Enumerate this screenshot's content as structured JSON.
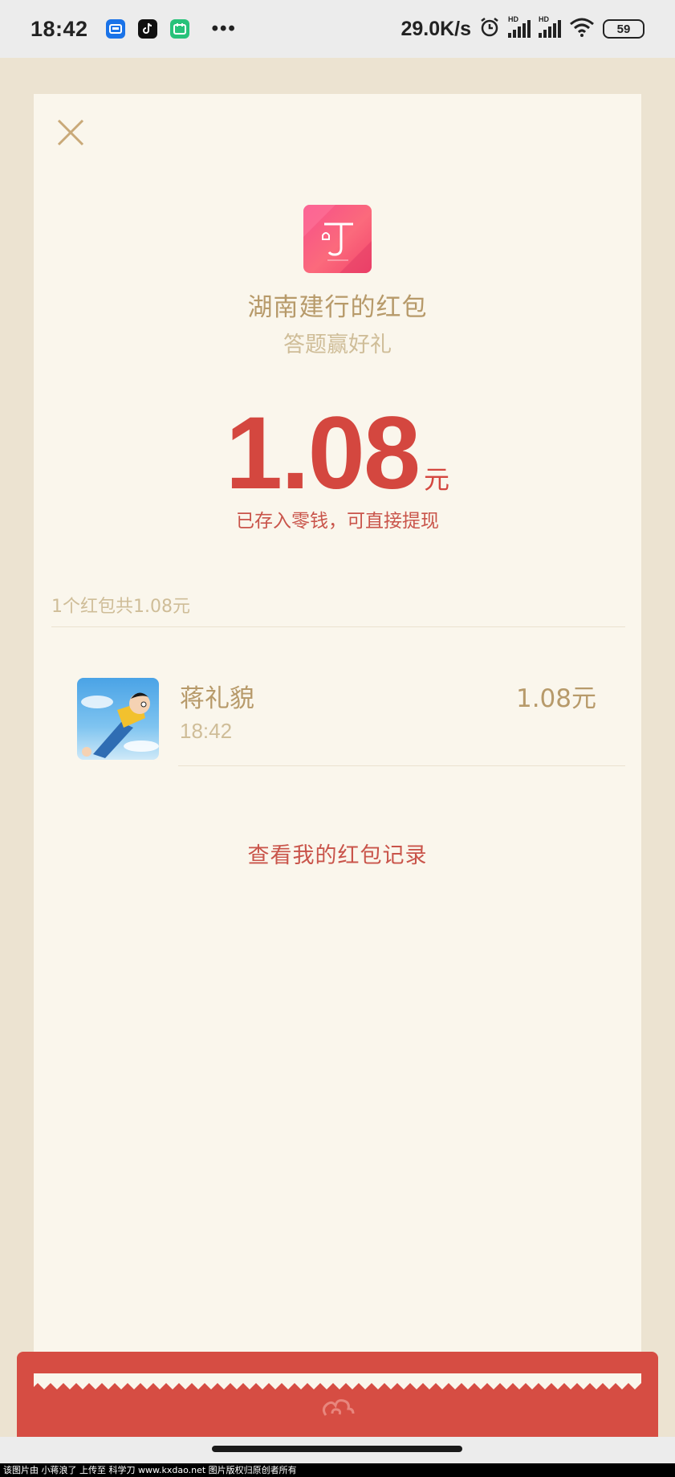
{
  "status_bar": {
    "time": "18:42",
    "app_icons": [
      "messenger-icon",
      "tiktok-icon",
      "calendar-icon"
    ],
    "more": "•••",
    "net_speed": "29.0K/s",
    "signal_label_1": "HD",
    "signal_label_2": "HD",
    "battery": "59"
  },
  "packet": {
    "sender_title": "湖南建行的红包",
    "greeting": "答题赢好礼",
    "amount": "1.08",
    "unit": "元",
    "saved_note": "已存入零钱，可直接提现"
  },
  "summary": "1个红包共1.08元",
  "records": [
    {
      "name": "蒋礼貌",
      "time": "18:42",
      "amount": "1.08元"
    }
  ],
  "records_link": "查看我的红包记录",
  "watermark": "该图片由 小蒋浪了 上传至 科学刀 www.kxdao.net 图片版权归原创者所有",
  "colors": {
    "background": "#ece3d1",
    "card": "#faf6ec",
    "amount": "#d4473f",
    "gold_text": "#b79a6a",
    "red_footer": "#d64d43"
  }
}
